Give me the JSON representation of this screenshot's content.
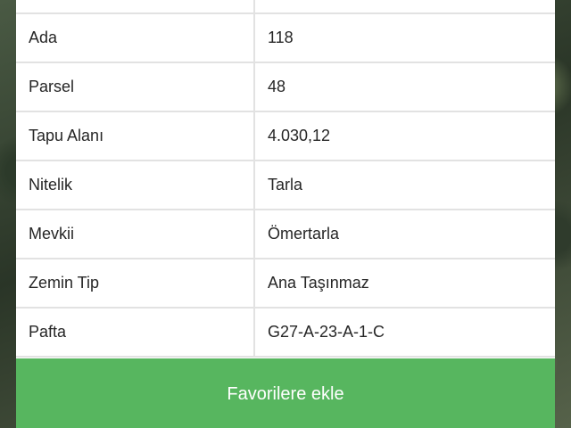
{
  "rows": [
    {
      "label": "",
      "value": ""
    },
    {
      "label": "Ada",
      "value": "118"
    },
    {
      "label": "Parsel",
      "value": "48"
    },
    {
      "label": "Tapu Alanı",
      "value": "4.030,12"
    },
    {
      "label": "Nitelik",
      "value": "Tarla"
    },
    {
      "label": "Mevkii",
      "value": "Ömertarla"
    },
    {
      "label": "Zemin Tip",
      "value": "Ana Taşınmaz"
    },
    {
      "label": "Pafta",
      "value": "G27-A-23-A-1-C"
    }
  ],
  "favorite_button": {
    "label": "Favorilere ekle"
  },
  "colors": {
    "button": "#57b65f",
    "divider": "#e2e2e2",
    "text": "#262626"
  }
}
